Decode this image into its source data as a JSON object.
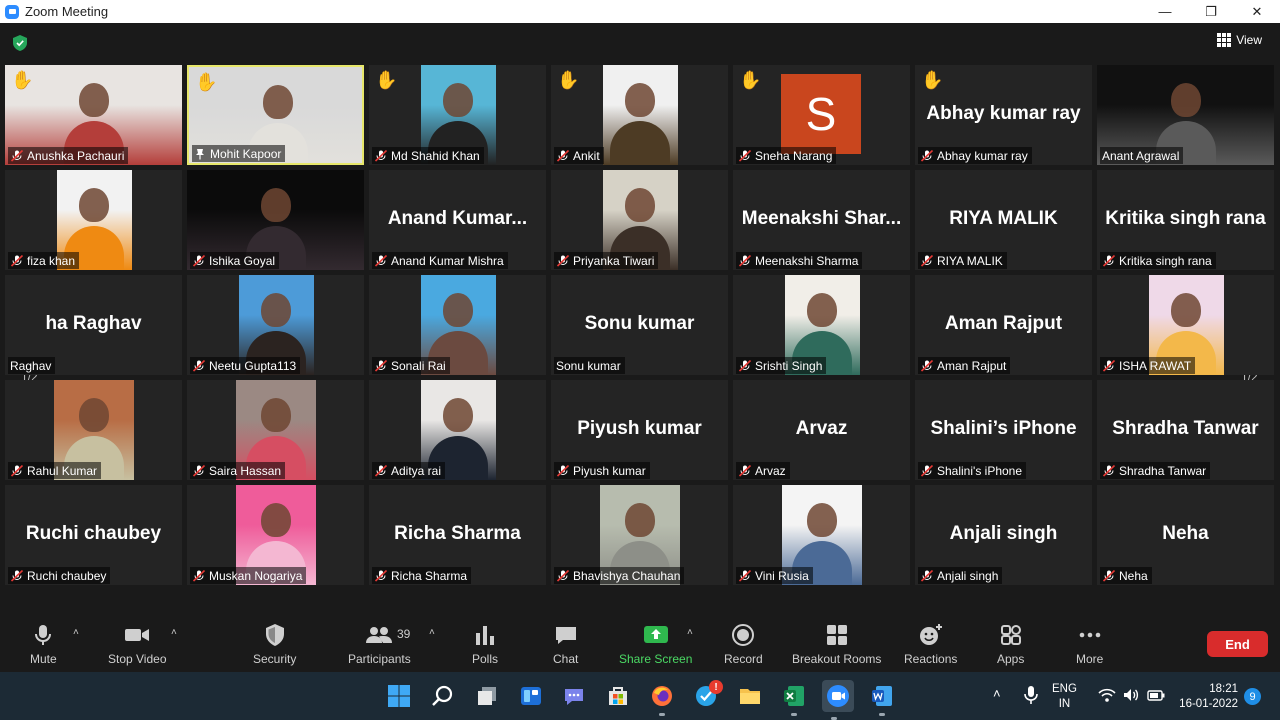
{
  "window": {
    "title": "Zoom Meeting"
  },
  "toolbar_top": {
    "view_label": "View"
  },
  "pager": {
    "page": "1/2"
  },
  "tiles": [
    {
      "big": "",
      "name": "Anushka Pachauri"
    },
    {
      "big": "",
      "name": "Mohit Kapoor"
    },
    {
      "big": "",
      "name": "Md Shahid Khan"
    },
    {
      "big": "",
      "name": "Ankit"
    },
    {
      "big": "",
      "name": "Sneha Narang",
      "avatar": "S"
    },
    {
      "big": "Abhay kumar ray",
      "name": "Abhay kumar ray"
    },
    {
      "big": "",
      "name": "Anant Agrawal"
    },
    {
      "big": "",
      "name": "fiza khan"
    },
    {
      "big": "",
      "name": "Ishika Goyal"
    },
    {
      "big": "Anand  Kumar...",
      "name": "Anand Kumar Mishra"
    },
    {
      "big": "",
      "name": "Priyanka Tiwari"
    },
    {
      "big": "Meenakshi  Shar...",
      "name": "Meenakshi Sharma"
    },
    {
      "big": "RIYA MALIK",
      "name": "RIYA MALIK"
    },
    {
      "big": "Kritika singh rana",
      "name": "Kritika singh rana"
    },
    {
      "big": "ha Raghav",
      "name": "Raghav"
    },
    {
      "big": "",
      "name": "Neetu Gupta113"
    },
    {
      "big": "",
      "name": "Sonali Rai"
    },
    {
      "big": "Sonu kumar",
      "name": "Sonu kumar"
    },
    {
      "big": "",
      "name": "Srishti Singh"
    },
    {
      "big": "Aman Rajput",
      "name": "Aman Rajput"
    },
    {
      "big": "",
      "name": "ISHA RAWAT"
    },
    {
      "big": "",
      "name": "Rahul Kumar"
    },
    {
      "big": "",
      "name": "Saira Hassan"
    },
    {
      "big": "",
      "name": "Aditya rai"
    },
    {
      "big": "Piyush kumar",
      "name": "Piyush kumar"
    },
    {
      "big": "Arvaz",
      "name": "Arvaz"
    },
    {
      "big": "Shalini’s iPhone",
      "name": "Shalini's iPhone"
    },
    {
      "big": "Shradha Tanwar",
      "name": "Shradha Tanwar"
    },
    {
      "big": "Ruchi chaubey",
      "name": "Ruchi chaubey"
    },
    {
      "big": "",
      "name": "Muskan Nogariya"
    },
    {
      "big": "Richa Sharma",
      "name": "Richa Sharma"
    },
    {
      "big": "",
      "name": "Bhavishya Chauhan"
    },
    {
      "big": "",
      "name": "Vini Rusia"
    },
    {
      "big": "Anjali singh",
      "name": "Anjali singh"
    },
    {
      "big": "Neha",
      "name": "Neha"
    }
  ],
  "controls": {
    "mute": "Mute",
    "stop_video": "Stop Video",
    "security": "Security",
    "participants": "Participants",
    "participants_count": "39",
    "polls": "Polls",
    "chat": "Chat",
    "share_screen": "Share Screen",
    "record": "Record",
    "breakout": "Breakout Rooms",
    "reactions": "Reactions",
    "apps": "Apps",
    "more": "More",
    "end": "End"
  },
  "taskbar": {
    "lang_1": "ENG",
    "lang_2": "IN",
    "time": "18:21",
    "date": "16-01-2022",
    "notif_count": "9",
    "mail_badge": "!"
  },
  "colors": {
    "accent_blue": "#2d8cff",
    "end_red": "#d92c2c",
    "share_green": "#4bd964",
    "active_border": "#e7e76b"
  }
}
